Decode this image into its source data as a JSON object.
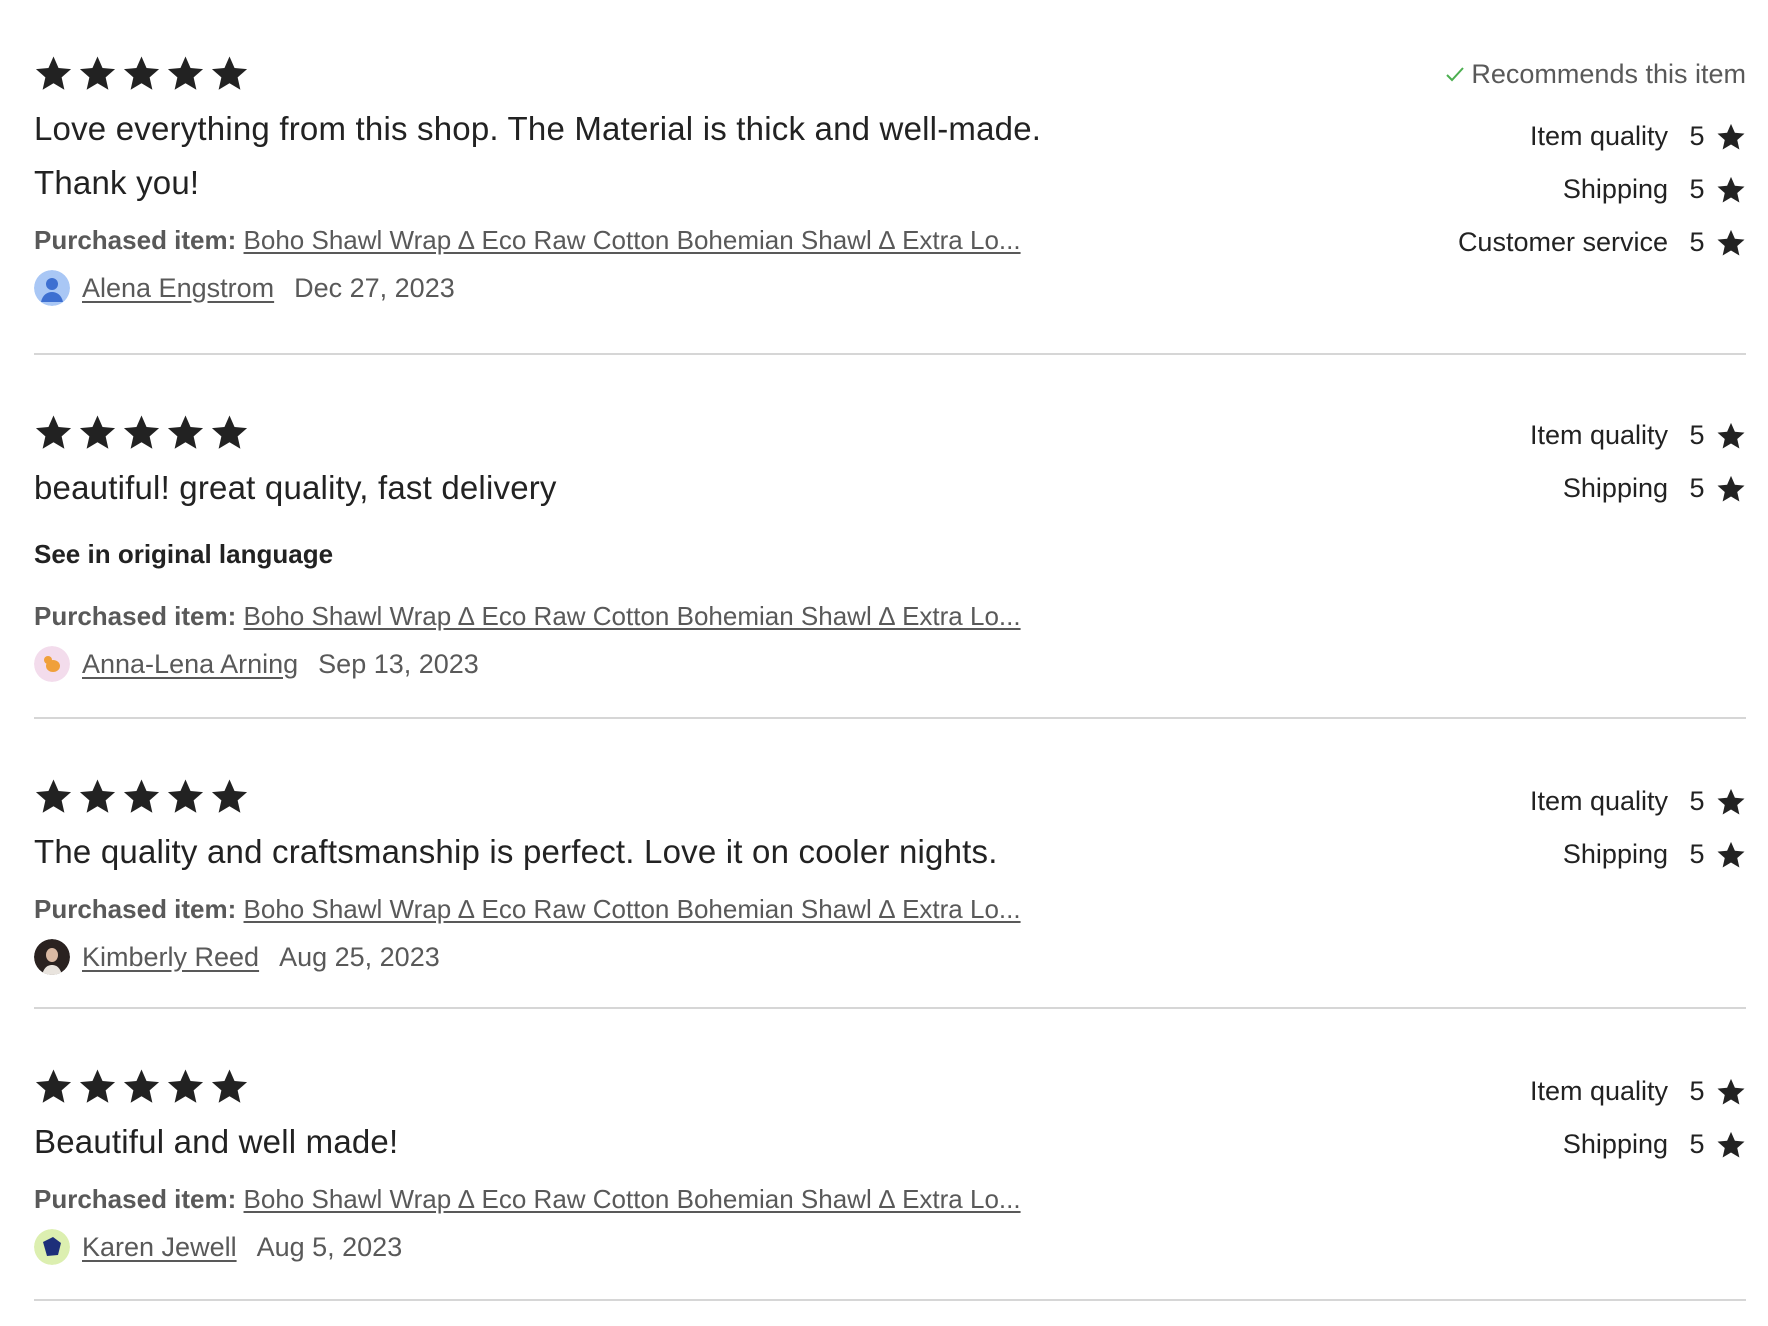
{
  "colors": {
    "text_primary": "#222222",
    "text_secondary": "#595959",
    "divider": "#d6d6d6",
    "check_green": "#4caf50"
  },
  "purchased_label": "Purchased item:",
  "reviews": [
    {
      "stars": 5,
      "text": "Love everything from this shop. The Material is thick and well-made. Thank you!",
      "show_original_language": false,
      "original_language_label": "",
      "purchased_item": "Boho Shawl Wrap ∆ Eco Raw Cotton Bohemian Shawl ∆ Extra Lo...",
      "reviewer": "Alena Engstrom",
      "date": "Dec 27, 2023",
      "avatar_icon": "default-user-icon",
      "recommends": "Recommends this item",
      "ratings": [
        {
          "label": "Item quality",
          "value": "5"
        },
        {
          "label": "Shipping",
          "value": "5"
        },
        {
          "label": "Customer service",
          "value": "5"
        }
      ]
    },
    {
      "stars": 5,
      "text": "beautiful! great quality, fast delivery",
      "show_original_language": true,
      "original_language_label": "See in original language",
      "purchased_item": "Boho Shawl Wrap ∆ Eco Raw Cotton Bohemian Shawl ∆ Extra Lo...",
      "reviewer": "Anna-Lena Arning",
      "date": "Sep 13, 2023",
      "avatar_icon": "orange-cat-icon",
      "recommends": "",
      "ratings": [
        {
          "label": "Item quality",
          "value": "5"
        },
        {
          "label": "Shipping",
          "value": "5"
        }
      ]
    },
    {
      "stars": 5,
      "text": "The quality and craftsmanship is perfect. Love it on cooler nights.",
      "show_original_language": false,
      "original_language_label": "",
      "purchased_item": "Boho Shawl Wrap ∆ Eco Raw Cotton Bohemian Shawl ∆ Extra Lo...",
      "reviewer": "Kimberly Reed",
      "date": "Aug 25, 2023",
      "avatar_icon": "photo-avatar-icon",
      "recommends": "",
      "ratings": [
        {
          "label": "Item quality",
          "value": "5"
        },
        {
          "label": "Shipping",
          "value": "5"
        }
      ]
    },
    {
      "stars": 5,
      "text": "Beautiful and well made!",
      "show_original_language": false,
      "original_language_label": "",
      "purchased_item": "Boho Shawl Wrap ∆ Eco Raw Cotton Bohemian Shawl ∆ Extra Lo...",
      "reviewer": "Karen Jewell",
      "date": "Aug 5, 2023",
      "avatar_icon": "blue-shape-avatar-icon",
      "recommends": "",
      "ratings": [
        {
          "label": "Item quality",
          "value": "5"
        },
        {
          "label": "Shipping",
          "value": "5"
        }
      ]
    }
  ]
}
